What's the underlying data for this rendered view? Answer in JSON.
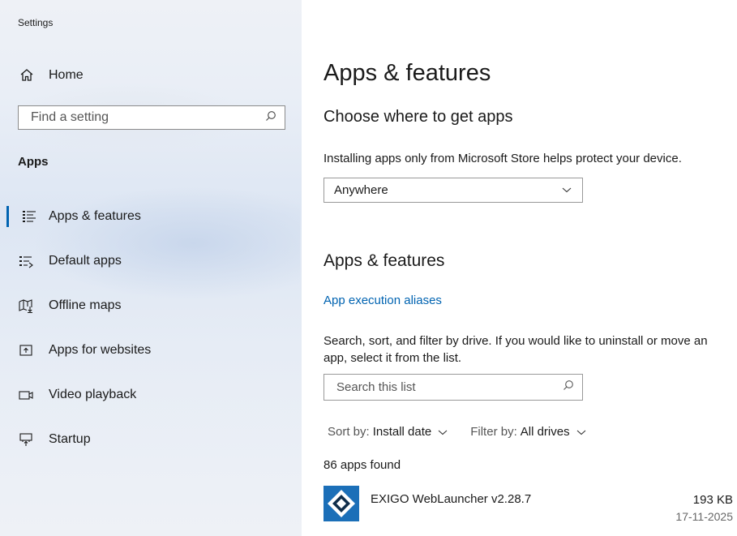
{
  "window": {
    "title": "Settings"
  },
  "sidebar": {
    "home_label": "Home",
    "search_placeholder": "Find a setting",
    "section_label": "Apps",
    "items": [
      {
        "label": "Apps & features",
        "icon": "apps-features-icon",
        "selected": true
      },
      {
        "label": "Default apps",
        "icon": "default-apps-icon",
        "selected": false
      },
      {
        "label": "Offline maps",
        "icon": "offline-maps-icon",
        "selected": false
      },
      {
        "label": "Apps for websites",
        "icon": "apps-for-websites-icon",
        "selected": false
      },
      {
        "label": "Video playback",
        "icon": "video-playback-icon",
        "selected": false
      },
      {
        "label": "Startup",
        "icon": "startup-icon",
        "selected": false
      }
    ]
  },
  "main": {
    "title": "Apps & features",
    "choose_heading": "Choose where to get apps",
    "choose_description": "Installing apps only from Microsoft Store helps protect your device.",
    "source_dropdown_value": "Anywhere",
    "apps_heading": "Apps & features",
    "aliases_link": "App execution aliases",
    "list_description": "Search, sort, and filter by drive. If you would like to uninstall or move an app, select it from the list.",
    "search_placeholder": "Search this list",
    "sort_label": "Sort by:",
    "sort_value": "Install date",
    "filter_label": "Filter by:",
    "filter_value": "All drives",
    "apps_found": "86 apps found",
    "apps": [
      {
        "name": "EXIGO WebLauncher v2.28.7",
        "size": "193 KB",
        "date": "17-11-2025"
      }
    ]
  },
  "colors": {
    "accent": "#0063b1",
    "app_icon_blue": "#1b6fb8"
  }
}
